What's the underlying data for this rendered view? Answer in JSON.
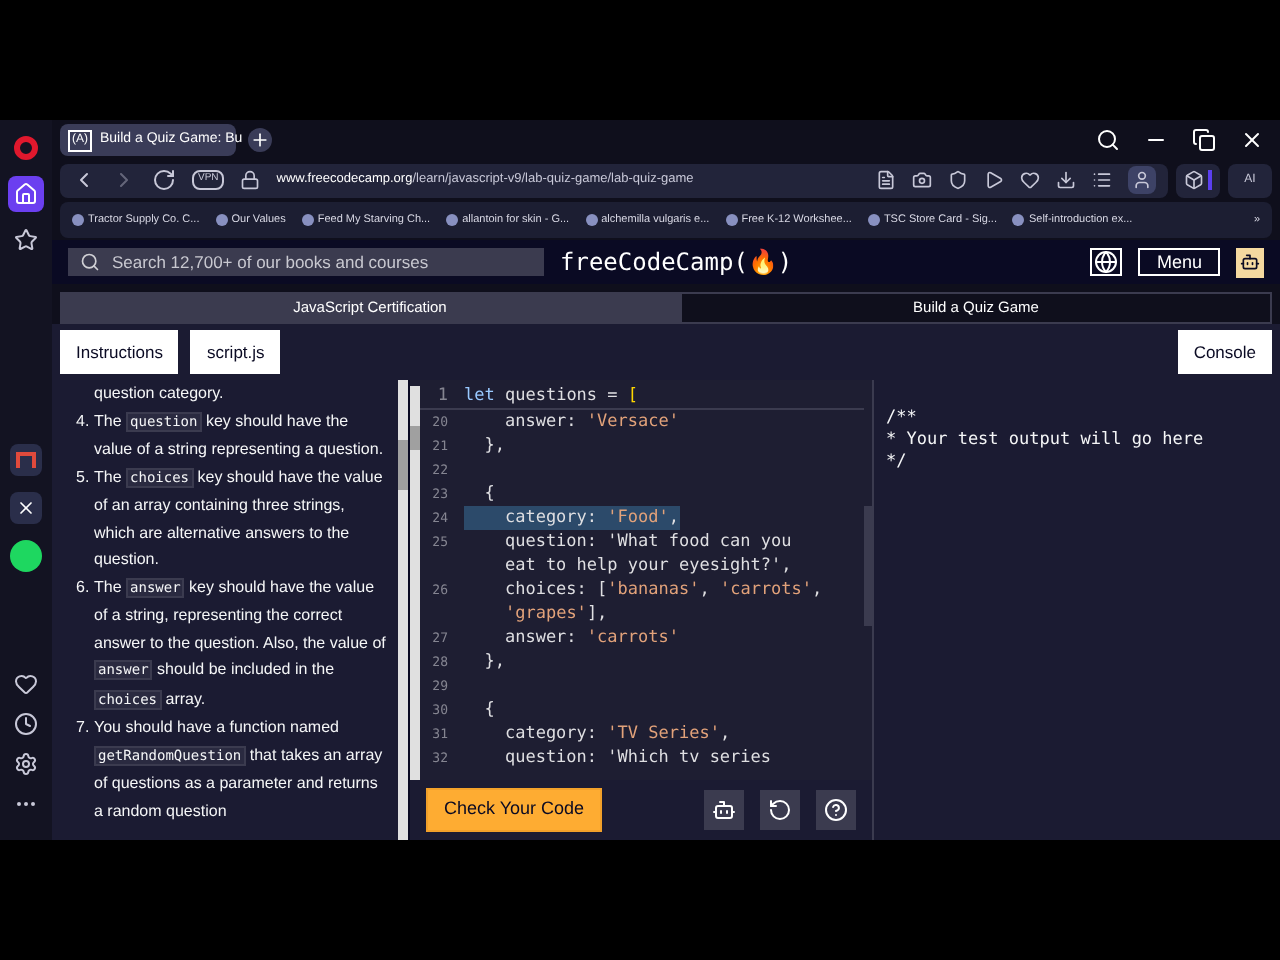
{
  "browser": {
    "tab": {
      "favicon": "(A)",
      "title": "Build a Quiz Game: Bu",
      "selected": true
    },
    "address": {
      "domain": "www.freecodecamp.org",
      "path": "/learn/javascript-v9/lab-quiz-game/lab-quiz-game"
    },
    "vpn_badge": "VPN",
    "ai_label": "AI",
    "bookmarks": [
      "Tractor Supply Co. C...",
      "Our Values",
      "Feed My Starving Ch...",
      "allantoin for skin - G...",
      "alchemilla vulgaris e...",
      "Free K-12 Workshee...",
      "TSC Store Card - Sig...",
      "Self-introduction ex..."
    ],
    "bookmarks_more": "»"
  },
  "site_nav": {
    "search": {
      "placeholder": "Search 12,700+ of our books and courses"
    },
    "logo": "freeCodeCamp(🔥)",
    "menu_button": "Menu"
  },
  "breadcrumb": [
    "JavaScript Certification",
    "Build a Quiz Game"
  ],
  "pane_tabs": [
    {
      "label": "Instructions",
      "selected": false
    },
    {
      "label": "script.js",
      "selected": false
    }
  ],
  "console_button": "Console",
  "instructions": {
    "top_fragment": "question category.",
    "items": [
      {
        "number": "4.",
        "parts": [
          {
            "t": "The "
          },
          {
            "code": "question"
          },
          {
            "t": " key should have the value of a string representing a question."
          }
        ]
      },
      {
        "number": "5.",
        "parts": [
          {
            "t": "The "
          },
          {
            "code": "choices"
          },
          {
            "t": " key should have the value of an array containing three strings, which are alternative answers to the question."
          }
        ]
      },
      {
        "number": "6.",
        "parts": [
          {
            "t": "The "
          },
          {
            "code": "answer"
          },
          {
            "t": " key should have the value of a string, representing the correct answer to the question. Also, the value of "
          },
          {
            "code": "answer"
          },
          {
            "t": " should be included in the "
          },
          {
            "code": "choices"
          },
          {
            "t": " array."
          }
        ]
      },
      {
        "number": "7.",
        "parts": [
          {
            "t": "You should have a function named "
          },
          {
            "code": "getRandomQuestion"
          },
          {
            "t": " that takes an array of questions as a parameter and returns a random question"
          }
        ]
      }
    ]
  },
  "editor": {
    "sticky_line": {
      "number": "1",
      "text": "let questions = ["
    },
    "lines": [
      {
        "number": "20",
        "rows": [
          "    answer: 'Versace'"
        ]
      },
      {
        "number": "21",
        "rows": [
          "  },"
        ]
      },
      {
        "number": "22",
        "rows": [
          ""
        ]
      },
      {
        "number": "23",
        "rows": [
          "  {"
        ]
      },
      {
        "number": "24",
        "rows": [
          "    category: 'Food',"
        ],
        "selected": true
      },
      {
        "number": "25",
        "rows": [
          "    question: 'What food can you",
          "    eat to help your eyesight?',"
        ]
      },
      {
        "number": "26",
        "rows": [
          "    choices: ['bananas', 'carrots',",
          "    'grapes'],"
        ]
      },
      {
        "number": "27",
        "rows": [
          "    answer: 'carrots'"
        ]
      },
      {
        "number": "28",
        "rows": [
          "  },"
        ]
      },
      {
        "number": "29",
        "rows": [
          ""
        ]
      },
      {
        "number": "30",
        "rows": [
          "  {"
        ]
      },
      {
        "number": "31",
        "rows": [
          "    category: 'TV Series',"
        ]
      },
      {
        "number": "32",
        "rows": [
          "    question: 'Which tv series"
        ]
      }
    ]
  },
  "check_button": "Check Your Code",
  "console_output": [
    "/**",
    "* Your test output will go here",
    "*/"
  ]
}
